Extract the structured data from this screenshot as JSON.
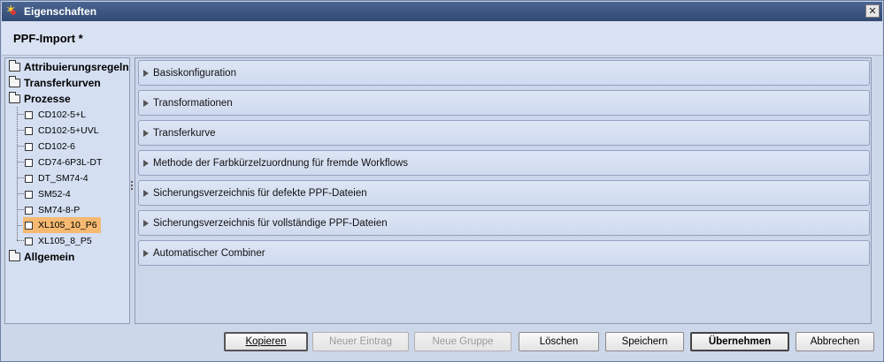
{
  "window": {
    "title": "Eigenschaften",
    "close_symbol": "✕"
  },
  "header": {
    "title": "PPF-Import *"
  },
  "tree": {
    "top": {
      "attribuierung": "Attribuierungsregeln",
      "transferkurven": "Transferkurven",
      "prozesse": "Prozesse",
      "allgemein": "Allgemein"
    },
    "prozesse_children": [
      "CD102-5+L",
      "CD102-5+UVL",
      "CD102-6",
      "CD74-6P3L-DT",
      "DT_SM74-4",
      "SM52-4",
      "SM74-8-P",
      "XL105_10_P6",
      "XL105_8_P5"
    ],
    "selected": "XL105_10_P6"
  },
  "sections": [
    "Basiskonfiguration",
    "Transformationen",
    "Transferkurve",
    "Methode der Farbkürzelzuordnung für fremde Workflows",
    "Sicherungsverzeichnis für defekte PPF-Dateien",
    "Sicherungsverzeichnis für vollständige PPF-Dateien",
    "Automatischer Combiner"
  ],
  "buttons": {
    "kopieren": "Kopieren",
    "neuer_eintrag": "Neuer Eintrag",
    "neue_gruppe": "Neue Gruppe",
    "loeschen": "Löschen",
    "speichern": "Speichern",
    "uebernehmen": "Übernehmen",
    "abbrechen": "Abbrechen"
  }
}
